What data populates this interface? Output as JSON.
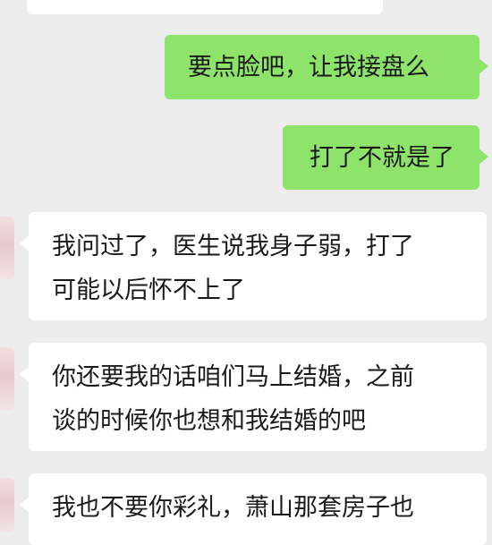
{
  "messages": [
    {
      "side": "received",
      "text": ""
    },
    {
      "side": "sent",
      "text": "要点脸吧，让我接盘么"
    },
    {
      "side": "sent",
      "text": "打了不就是了"
    },
    {
      "side": "received",
      "lines": [
        "我问过了，医生说我身子弱，打了",
        "可能以后怀不上了"
      ]
    },
    {
      "side": "received",
      "lines": [
        "你还要我的话咱们马上结婚，之前",
        "谈的时候你也想和我结婚的吧"
      ]
    },
    {
      "side": "received",
      "lines": [
        "我也不要你彩礼，萧山那套房子也"
      ]
    }
  ],
  "colors": {
    "background": "#ececec",
    "sent_bubble": "#8ee36a",
    "received_bubble": "#ffffff"
  }
}
